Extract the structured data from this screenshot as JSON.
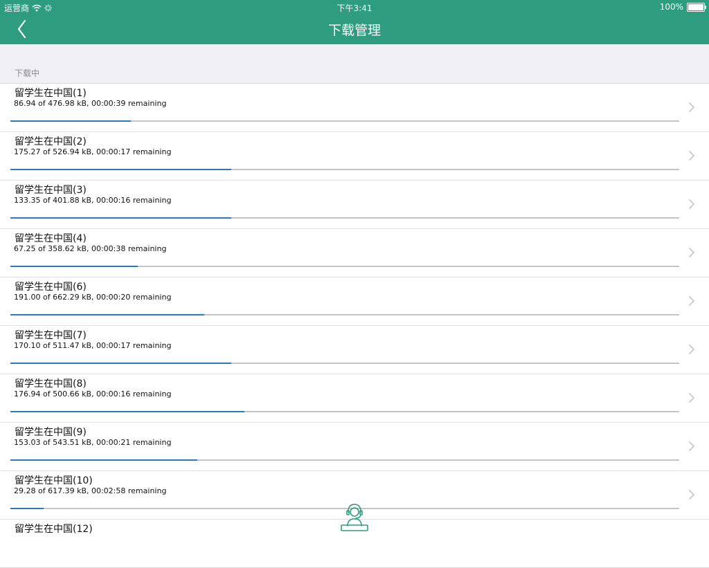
{
  "status_bar": {
    "carrier": "运营商",
    "time": "下午3:41",
    "battery": "100%"
  },
  "nav": {
    "title": "下载管理",
    "back_icon": "chevron-left-icon"
  },
  "section": {
    "title": "下载中"
  },
  "downloads": [
    {
      "title": "留学生在中国(1)",
      "detail": "86.94 of 476.98 kB, 00:00:39 remaining",
      "progress": 0.18
    },
    {
      "title": "留学生在中国(2)",
      "detail": "175.27 of 526.94 kB, 00:00:17 remaining",
      "progress": 0.33
    },
    {
      "title": "留学生在中国(3)",
      "detail": "133.35 of 401.88 kB, 00:00:16 remaining",
      "progress": 0.33
    },
    {
      "title": "留学生在中国(4)",
      "detail": "67.25 of 358.62 kB, 00:00:38 remaining",
      "progress": 0.19
    },
    {
      "title": "留学生在中国(6)",
      "detail": "191.00 of 662.29 kB, 00:00:20 remaining",
      "progress": 0.29
    },
    {
      "title": "留学生在中国(7)",
      "detail": "170.10 of 511.47 kB, 00:00:17 remaining",
      "progress": 0.33
    },
    {
      "title": "留学生在中国(8)",
      "detail": "176.94 of 500.66 kB, 00:00:16 remaining",
      "progress": 0.35
    },
    {
      "title": "留学生在中国(9)",
      "detail": "153.03 of 543.51 kB, 00:00:21 remaining",
      "progress": 0.28
    },
    {
      "title": "留学生在中国(10)",
      "detail": "29.28 of 617.39 kB, 00:02:58 remaining",
      "progress": 0.05
    },
    {
      "title": "留学生在中国(12)",
      "detail": "",
      "progress": 0
    }
  ],
  "colors": {
    "nav_background": "#2e9c7f",
    "progress_fill": "#2a7ab8",
    "progress_track": "#c4c4c4"
  },
  "bottom_icon": "customer-service-icon"
}
